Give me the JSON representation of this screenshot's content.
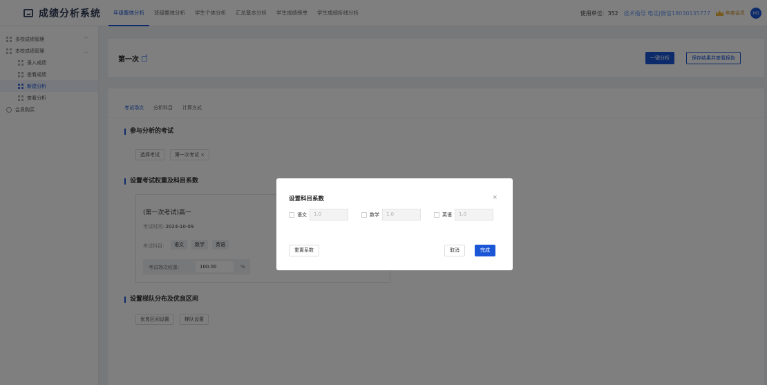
{
  "app": {
    "title": "成绩分析系统"
  },
  "topnav": {
    "tabs": [
      {
        "label": "年级整体分析",
        "active": true
      },
      {
        "label": "班级整体分析",
        "active": false
      },
      {
        "label": "学生个体分析",
        "active": false
      },
      {
        "label": "汇总基本分析",
        "active": false
      },
      {
        "label": "学生成绩榜单",
        "active": false
      },
      {
        "label": "学生成绩折线分析",
        "active": false
      }
    ]
  },
  "topright": {
    "unit_label": "使用单位:",
    "unit_value": "352",
    "contact": "技术指导 电话|微信18030135777",
    "vip_label": "年度会员",
    "avatar_text": "HO"
  },
  "sidebar": {
    "items": [
      {
        "label": "多校成绩管理",
        "icon": "grid-icon",
        "chevron": "﹀"
      },
      {
        "label": "本校成绩管理",
        "icon": "grid-icon",
        "chevron": "︿"
      },
      {
        "label": "录入成绩",
        "icon": "grid-icon",
        "sub": true
      },
      {
        "label": "查看成绩",
        "icon": "grid-icon",
        "sub": true
      },
      {
        "label": "新建分析",
        "icon": "grid-icon",
        "sub": true,
        "selected": true
      },
      {
        "label": "查看分析",
        "icon": "grid-icon",
        "sub": true
      },
      {
        "label": "会员购买",
        "icon": "circle-icon"
      }
    ]
  },
  "header": {
    "title": "第一次",
    "btn_analyze": "一键分析",
    "btn_save": "保存结果并查看报告"
  },
  "main": {
    "tabs": [
      {
        "label": "考试场次",
        "active": true
      },
      {
        "label": "分析科目",
        "active": false
      },
      {
        "label": "计算方式",
        "active": false
      }
    ],
    "section1": {
      "title": "参与分析的考试",
      "btn_select": "选择考试",
      "chip_exam": "第一次考试 ×"
    },
    "section2": {
      "title": "设置考试权重及科目系数",
      "exam_name": "(第一次考试)高一",
      "date_label": "考试时间:",
      "date_value": "2024-10-09",
      "subject_label": "考试科目:",
      "subjects": [
        "语文",
        "数学",
        "英语"
      ],
      "weight_label": "考试场次权重:",
      "weight_value": "100.00",
      "weight_unit": "%"
    },
    "section3": {
      "title": "设置梯队分布及优良区间",
      "btn_range": "优良区间设置",
      "btn_tier": "梯队设置"
    }
  },
  "modal": {
    "title": "设置科目系数",
    "close": "×",
    "coefficients": [
      {
        "subject": "语文",
        "value": "1.0"
      },
      {
        "subject": "数学",
        "value": "1.0"
      },
      {
        "subject": "英语",
        "value": "1.0"
      }
    ],
    "btn_reset": "重置系数",
    "btn_cancel": "取消",
    "btn_done": "完成"
  }
}
